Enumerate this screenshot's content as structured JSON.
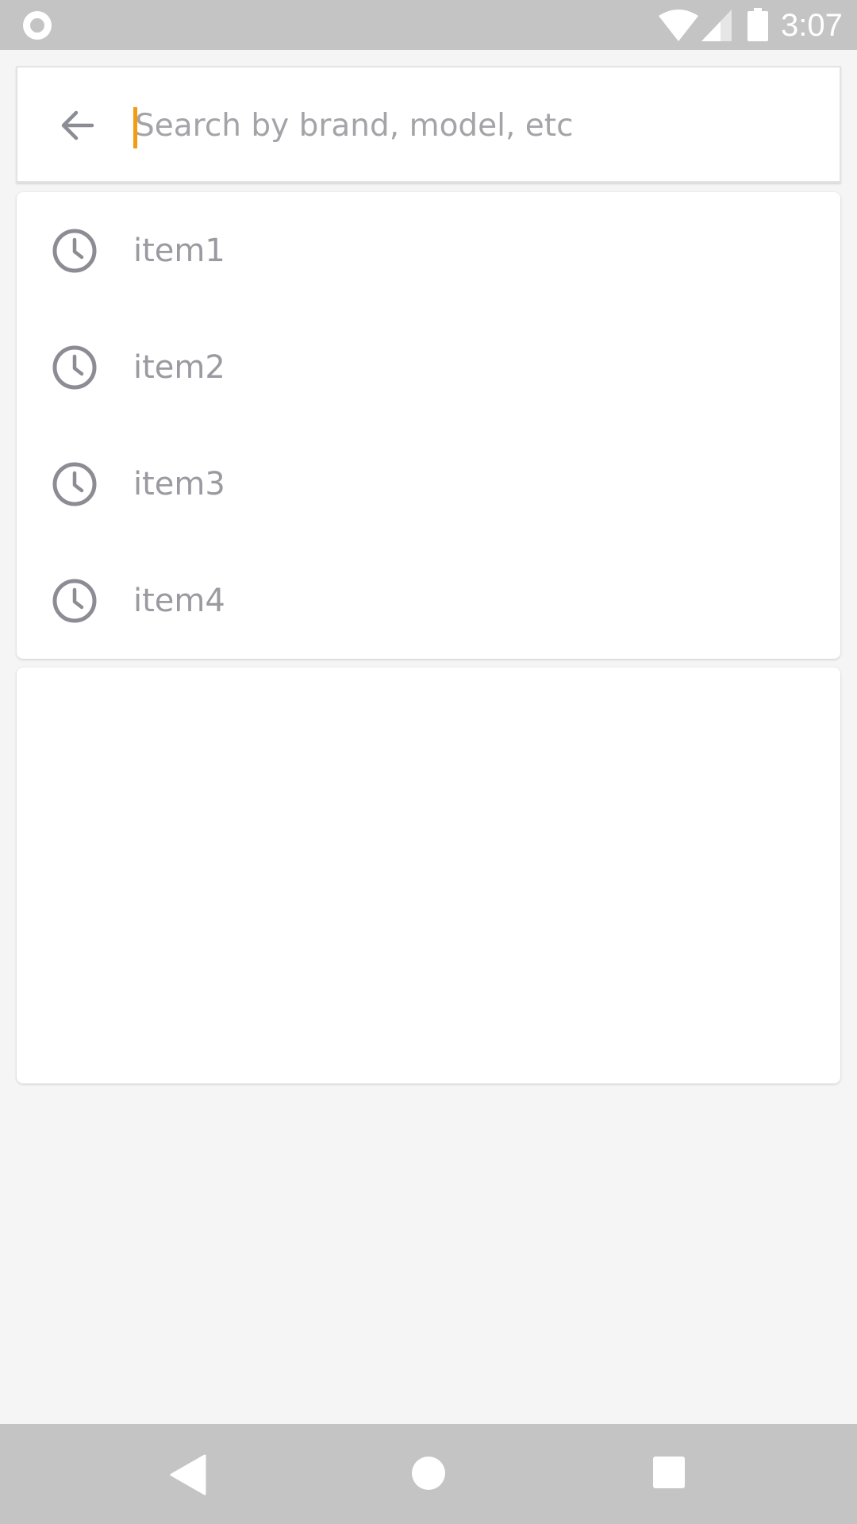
{
  "status_bar": {
    "time": "3:07",
    "left_icon": "record-indicator-icon",
    "icons": [
      "wifi-icon",
      "cell-signal-icon",
      "battery-icon"
    ]
  },
  "search": {
    "back_icon": "arrow-left-icon",
    "placeholder": "Search by brand, model, etc",
    "value": "",
    "caret_color": "#f39c12"
  },
  "history": {
    "item_icon": "clock-icon",
    "items": [
      {
        "label": "item1"
      },
      {
        "label": "item2"
      },
      {
        "label": "item3"
      },
      {
        "label": "item4"
      }
    ]
  },
  "nav_bar": {
    "buttons": [
      "back-triangle-icon",
      "home-circle-icon",
      "recents-square-icon"
    ]
  }
}
